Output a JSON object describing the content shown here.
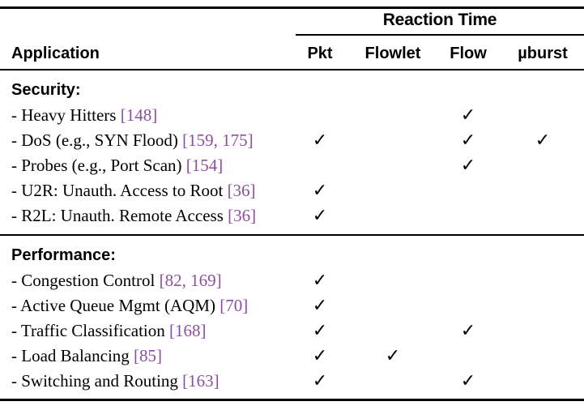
{
  "table": {
    "group_header": "Reaction Time",
    "row_header": "Application",
    "columns": [
      {
        "key": "pkt",
        "label": "Pkt",
        "center": 395
      },
      {
        "key": "flowlet",
        "label": "Flowlet",
        "center": 485
      },
      {
        "key": "flow",
        "label": "Flow",
        "center": 578
      },
      {
        "key": "uburst",
        "label": "µburst",
        "center": 670
      }
    ],
    "check_glyph": "✓",
    "citation_color": "#8e4ea0",
    "sections": [
      {
        "title": "Security:",
        "rows": [
          {
            "prefix": "- ",
            "name": "Heavy Hitters ",
            "cite": "[148]",
            "marks": {
              "pkt": false,
              "flowlet": false,
              "flow": true,
              "uburst": false
            }
          },
          {
            "prefix": "- ",
            "name": "DoS (e.g., SYN Flood) ",
            "cite": "[159, 175]",
            "marks": {
              "pkt": true,
              "flowlet": false,
              "flow": true,
              "uburst": true
            }
          },
          {
            "prefix": "- ",
            "name": "Probes (e.g., Port Scan) ",
            "cite": "[154]",
            "marks": {
              "pkt": false,
              "flowlet": false,
              "flow": true,
              "uburst": false
            }
          },
          {
            "prefix": "- ",
            "name": "U2R: Unauth. Access to Root ",
            "cite": "[36]",
            "marks": {
              "pkt": true,
              "flowlet": false,
              "flow": false,
              "uburst": false
            }
          },
          {
            "prefix": "- ",
            "name": "R2L: Unauth. Remote Access ",
            "cite": "[36]",
            "marks": {
              "pkt": true,
              "flowlet": false,
              "flow": false,
              "uburst": false
            }
          }
        ]
      },
      {
        "title": "Performance:",
        "rows": [
          {
            "prefix": "- ",
            "name": "Congestion Control ",
            "cite": "[82, 169]",
            "marks": {
              "pkt": true,
              "flowlet": false,
              "flow": false,
              "uburst": false
            }
          },
          {
            "prefix": "- ",
            "name": "Active Queue Mgmt (AQM) ",
            "cite": "[70]",
            "marks": {
              "pkt": true,
              "flowlet": false,
              "flow": false,
              "uburst": false
            }
          },
          {
            "prefix": "- ",
            "name": "Traffic Classification ",
            "cite": "[168]",
            "marks": {
              "pkt": true,
              "flowlet": false,
              "flow": true,
              "uburst": false
            }
          },
          {
            "prefix": "- ",
            "name": "Load Balancing ",
            "cite": "[85]",
            "marks": {
              "pkt": true,
              "flowlet": true,
              "flow": false,
              "uburst": false
            }
          },
          {
            "prefix": "- ",
            "name": "Switching and Routing ",
            "cite": "[163]",
            "marks": {
              "pkt": true,
              "flowlet": false,
              "flow": true,
              "uburst": false
            }
          }
        ]
      }
    ]
  }
}
